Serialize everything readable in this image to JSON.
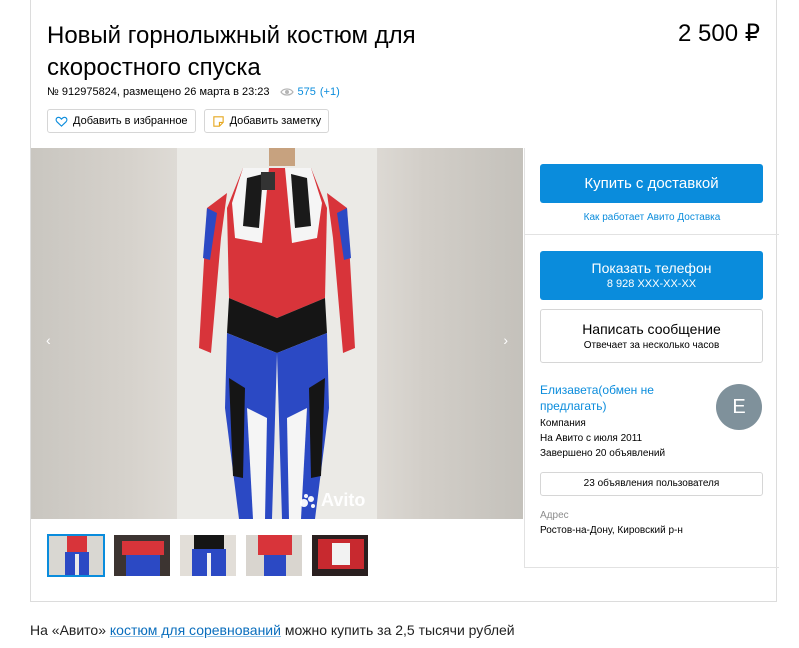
{
  "listing": {
    "title": "Новый горнолыжный костюм для скоростного спуска",
    "price": "2 500 ₽",
    "meta_text": "№ 912975824, размещено 26 марта в 23:23",
    "views": "575",
    "views_delta": "(+1)",
    "favorite_label": "Добавить в избранное",
    "note_label": "Добавить заметку"
  },
  "gallery": {
    "watermark": "Avito",
    "prev_arrow": "‹",
    "next_arrow": "›",
    "thumbnail_count": 5
  },
  "sidebar": {
    "buy_label": "Купить с доставкой",
    "delivery_link": "Как работает Авито Доставка",
    "phone_label": "Показать телефон",
    "phone_number": "8 928 XXX-XX-XX",
    "message_label": "Написать сообщение",
    "message_sub": "Отвечает за несколько часов"
  },
  "seller": {
    "name": "Елизавета(обмен не предлагать)",
    "type": "Компания",
    "since": "На Авито с июля 2011",
    "completed": "Завершено 20 объявлений",
    "avatar_letter": "E",
    "ads_button": "23 объявления пользователя",
    "address_label": "Адрес",
    "address_value": "Ростов-на-Дону, Кировский р-н"
  },
  "caption": {
    "before": "На «Авито» ",
    "link": "костюм для соревнований",
    "after": " можно купить за 2,5 тысячи рублей"
  },
  "colors": {
    "accent": "#0a8cdc",
    "avatar_bg": "#7f919b",
    "suit_red": "#d8343a",
    "suit_blue": "#2b49c4"
  },
  "icons": [
    "heart-icon",
    "note-icon",
    "eye-icon",
    "avito-logo-icon"
  ]
}
